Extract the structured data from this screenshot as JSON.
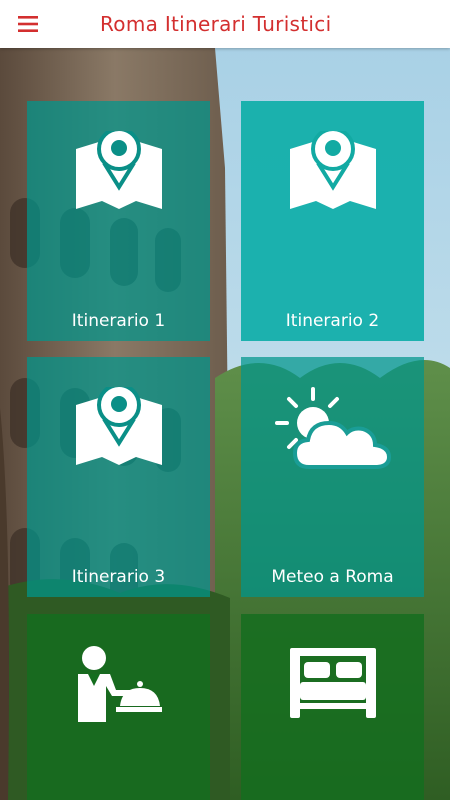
{
  "app_bar": {
    "title": "Roma Itinerari Turistici",
    "menu_icon": "hamburger-menu-icon",
    "accent_color": "#d32f2f"
  },
  "tiles": [
    {
      "label": "Itinerario 1",
      "icon": "map-pin-icon"
    },
    {
      "label": "Itinerario 2",
      "icon": "map-pin-icon"
    },
    {
      "label": "Itinerario 3",
      "icon": "map-pin-icon"
    },
    {
      "label": "Meteo a Roma",
      "icon": "weather-sun-cloud-icon"
    },
    {
      "label": "",
      "icon": "waiter-icon"
    },
    {
      "label": "",
      "icon": "bed-icon"
    }
  ],
  "colors": {
    "tile_teal": "#00968c",
    "tile_teal_light": "#0eaea8",
    "tile_green": "#146e1e"
  }
}
